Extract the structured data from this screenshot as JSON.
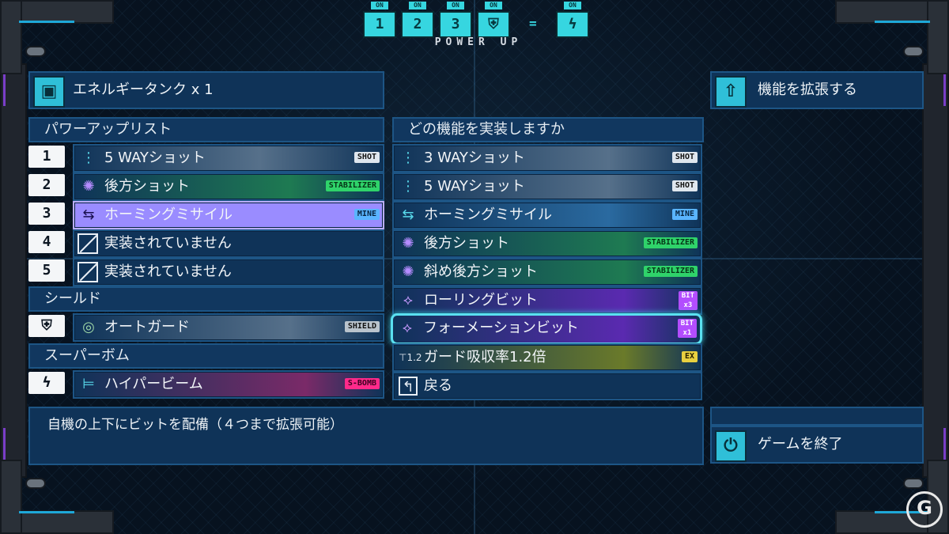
{
  "power_up": {
    "on_label": "ON",
    "slots": [
      "1",
      "2",
      "3",
      "shield-icon"
    ],
    "equals": "=",
    "bomb_slot": "lightning-icon",
    "label": "POWER UP"
  },
  "energy_tank": {
    "label": "エネルギータンク x 1"
  },
  "power_list": {
    "header": "パワーアップリスト",
    "items": [
      {
        "num": "1",
        "label": "5 WAYショット",
        "tag": "SHOT"
      },
      {
        "num": "2",
        "label": "後方ショット",
        "tag": "STABILIZER"
      },
      {
        "num": "3",
        "label": "ホーミングミサイル",
        "tag": "MINE"
      },
      {
        "num": "4",
        "label": "実装されていません",
        "tag": ""
      },
      {
        "num": "5",
        "label": "実装されていません",
        "tag": ""
      }
    ]
  },
  "shield": {
    "header": "シールド",
    "label": "オートガード",
    "tag": "SHIELD"
  },
  "super_bomb": {
    "header": "スーパーボム",
    "label": "ハイパービーム",
    "tag": "S-BOMB"
  },
  "implement_menu": {
    "header": "どの機能を実装しますか",
    "items": [
      {
        "label": "3 WAYショット",
        "tag": "SHOT"
      },
      {
        "label": "5 WAYショット",
        "tag": "SHOT"
      },
      {
        "label": "ホーミングミサイル",
        "tag": "MINE"
      },
      {
        "label": "後方ショット",
        "tag": "STABILIZER"
      },
      {
        "label": "斜め後方ショット",
        "tag": "STABILIZER"
      },
      {
        "label": "ローリングビット",
        "tag": "BIT",
        "tag_sub": "x3"
      },
      {
        "label": "フォーメーションビット",
        "tag": "BIT",
        "tag_sub": "x1",
        "selected": true
      },
      {
        "label": "ガード吸収率1.2倍",
        "tag": "EX"
      },
      {
        "label": "戻る",
        "tag": ""
      }
    ]
  },
  "right_menu": {
    "expand": "機能を拡張する",
    "quit": "ゲームを終了"
  },
  "description": "自機の上下にビットを配備（４つまで拡張可能）",
  "watermark": "G",
  "colors": {
    "panel": "#0f3358",
    "border": "#1d5585",
    "accent_cyan": "#36d6e0",
    "selected_purple": "#9a8cff"
  }
}
